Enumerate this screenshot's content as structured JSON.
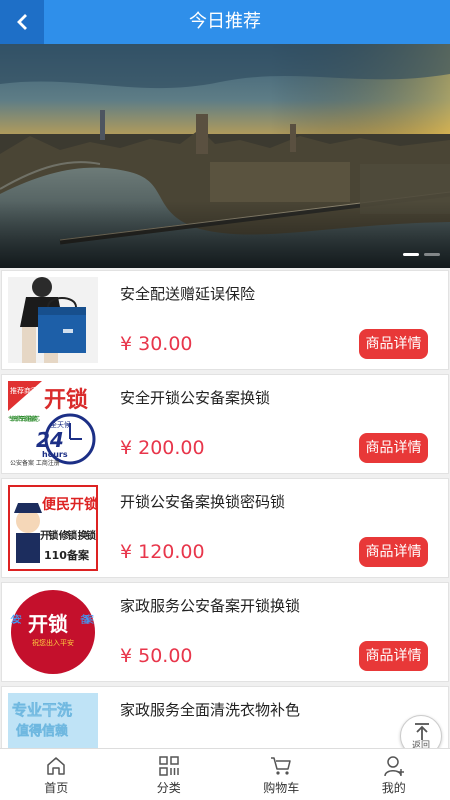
{
  "header": {
    "title": "今日推荐"
  },
  "banner": {
    "slides": 2,
    "active_index": 0
  },
  "products": [
    {
      "name": "安全配送赠延误保险",
      "price": "¥ 30.00",
      "detail_label": "商品详情",
      "thumb_icon": "delivery-bag-icon"
    },
    {
      "name": "安全开锁公安备案换锁",
      "price": "¥ 200.00",
      "detail_label": "商品详情",
      "thumb_icon": "unlock-24h-icon",
      "thumb_text": {
        "title": "开锁",
        "badge": "推荐商家",
        "hours": "24",
        "hours_unit": "hours",
        "allday": "全天候",
        "side": "专业开锁汽车开锁防盗锁换芯",
        "bottom": "公安备案 工商注册"
      }
    },
    {
      "name": "开锁公安备案换锁密码锁",
      "price": "¥ 120.00",
      "detail_label": "商品详情",
      "thumb_icon": "police-locksmith-icon",
      "thumb_text": {
        "title": "便民开锁",
        "services": "开锁 修锁 换锁",
        "record": "110备案"
      }
    },
    {
      "name": "家政服务公安备案开锁换锁",
      "price": "¥ 50.00",
      "detail_label": "商品详情",
      "thumb_icon": "unlock-circle-icon",
      "thumb_text": {
        "left": "公安",
        "title": "开锁",
        "right": "备案",
        "sub": "祝您出入平安"
      }
    },
    {
      "name": "家政服务全面清洗衣物补色",
      "price": "",
      "detail_label": "",
      "thumb_icon": "laundry-icon",
      "thumb_text": {
        "line1": "专业干洗",
        "line2": "值得信赖"
      }
    }
  ],
  "back_to_top": {
    "label": "返回"
  },
  "tabbar": [
    {
      "label": "首页",
      "icon": "home-icon"
    },
    {
      "label": "分类",
      "icon": "category-grid-icon"
    },
    {
      "label": "购物车",
      "icon": "cart-icon"
    },
    {
      "label": "我的",
      "icon": "user-icon"
    }
  ],
  "colors": {
    "header": "#2f8fea",
    "back_button": "#1e6fc7",
    "price": "#e8364b",
    "detail_button": "#e83838"
  }
}
